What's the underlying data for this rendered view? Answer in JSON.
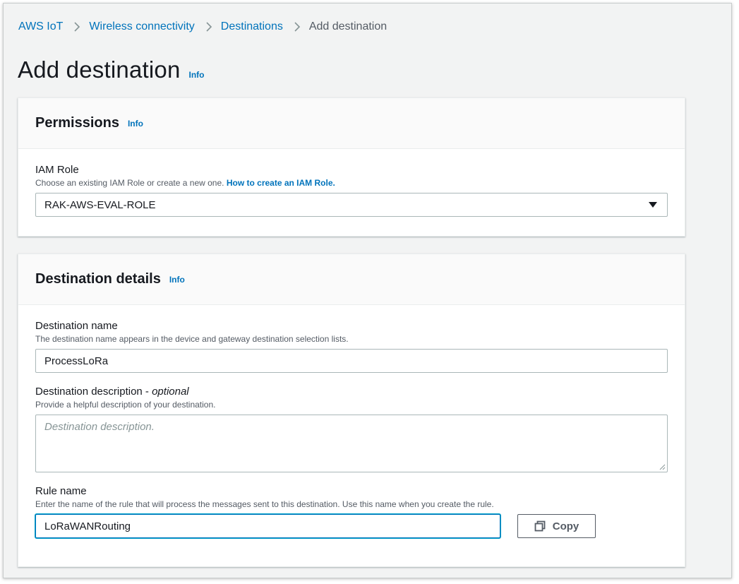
{
  "breadcrumb": {
    "items": [
      "AWS IoT",
      "Wireless connectivity",
      "Destinations"
    ],
    "current": "Add destination"
  },
  "page": {
    "title": "Add destination",
    "info": "Info"
  },
  "permissions": {
    "title": "Permissions",
    "info": "Info",
    "iam_role": {
      "label": "IAM Role",
      "description": "Choose an existing IAM Role or create a new one. ",
      "description_link": "How to create an IAM Role.",
      "selected": "RAK-AWS-EVAL-ROLE"
    }
  },
  "destination_details": {
    "title": "Destination details",
    "info": "Info",
    "name": {
      "label": "Destination name",
      "description": "The destination name appears in the device and gateway destination selection lists.",
      "value": "ProcessLoRa"
    },
    "description_field": {
      "label": "Destination description - ",
      "label_optional": "optional",
      "description": "Provide a helpful description of your destination.",
      "placeholder": "Destination description."
    },
    "rule": {
      "label": "Rule name",
      "description": "Enter the name of the rule that will process the messages sent to this destination. Use this name when you create the rule.",
      "value": "LoRaWANRouting",
      "copy_label": "Copy"
    }
  },
  "colors": {
    "link": "#0073bb",
    "background": "#f2f3f3",
    "text": "#16191f",
    "focus": "#00a1c9"
  }
}
